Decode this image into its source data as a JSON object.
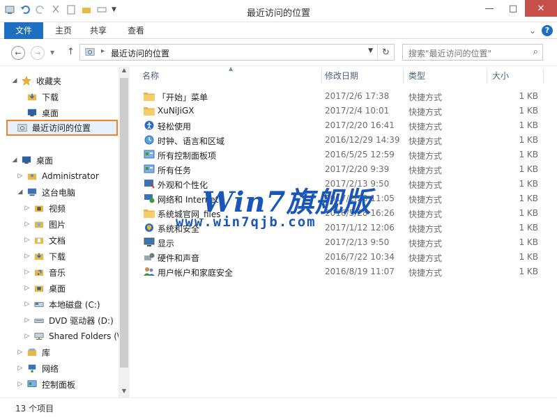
{
  "window": {
    "title": "最近访问的位置",
    "minimize": "—",
    "maximize": "□",
    "close": "✕"
  },
  "ribbon": {
    "tabs": [
      "文件",
      "主页",
      "共享",
      "查看"
    ],
    "expand": "⌄",
    "help": "?"
  },
  "address": {
    "path": "最近访问的位置",
    "separator": "▸",
    "dropdown": "▼",
    "refresh": "↻"
  },
  "search": {
    "placeholder": "搜索\"最近访问的位置\"",
    "icon": "⌕"
  },
  "nav_buttons": {
    "back": "←",
    "forward": "→",
    "up": "↑"
  },
  "tree": {
    "favorites": {
      "label": "收藏夹",
      "items": [
        "下载",
        "桌面",
        "最近访问的位置"
      ]
    },
    "desktop": {
      "label": "桌面",
      "children": [
        {
          "label": "Administrator"
        },
        {
          "label": "这台电脑",
          "children": [
            "视频",
            "图片",
            "文档",
            "下载",
            "音乐",
            "桌面",
            "本地磁盘 (C:)",
            "DVD 驱动器 (D:)",
            "Shared Folders (\\"
          ]
        },
        {
          "label": "库"
        },
        {
          "label": "网络"
        },
        {
          "label": "控制面板"
        }
      ]
    }
  },
  "columns": [
    "名称",
    "修改日期",
    "类型",
    "大小"
  ],
  "files": [
    {
      "name": "「开始」菜单",
      "date": "2017/2/6 17:38",
      "type": "快捷方式",
      "size": "1 KB",
      "icon": "folder-icon"
    },
    {
      "name": "XuNiJiGX",
      "date": "2017/2/4 10:01",
      "type": "快捷方式",
      "size": "1 KB",
      "icon": "folder-icon"
    },
    {
      "name": "轻松使用",
      "date": "2017/2/20 16:41",
      "type": "快捷方式",
      "size": "1 KB",
      "icon": "accessibility-icon"
    },
    {
      "name": "时钟、语言和区域",
      "date": "2016/12/29 14:39",
      "type": "快捷方式",
      "size": "1 KB",
      "icon": "clock-globe-icon"
    },
    {
      "name": "所有控制面板项",
      "date": "2016/5/25 12:59",
      "type": "快捷方式",
      "size": "1 KB",
      "icon": "control-panel-icon"
    },
    {
      "name": "所有任务",
      "date": "2017/2/20 9:39",
      "type": "快捷方式",
      "size": "1 KB",
      "icon": "control-panel-icon"
    },
    {
      "name": "外观和个性化",
      "date": "2017/2/13 9:50",
      "type": "快捷方式",
      "size": "1 KB",
      "icon": "appearance-icon"
    },
    {
      "name": "网络和 Internet",
      "date": "2017/2/23 11:05",
      "type": "快捷方式",
      "size": "1 KB",
      "icon": "network-icon"
    },
    {
      "name": "系统城官网_files",
      "date": "2016/5/28 16:26",
      "type": "快捷方式",
      "size": "1 KB",
      "icon": "folder-icon"
    },
    {
      "name": "系统和安全",
      "date": "2017/1/12 12:06",
      "type": "快捷方式",
      "size": "1 KB",
      "icon": "security-icon"
    },
    {
      "name": "显示",
      "date": "2017/2/13 9:50",
      "type": "快捷方式",
      "size": "1 KB",
      "icon": "display-icon"
    },
    {
      "name": "硬件和声音",
      "date": "2016/7/22 10:34",
      "type": "快捷方式",
      "size": "1 KB",
      "icon": "hardware-icon"
    },
    {
      "name": "用户帐户和家庭安全",
      "date": "2016/8/19 11:07",
      "type": "快捷方式",
      "size": "1 KB",
      "icon": "users-icon"
    }
  ],
  "status": {
    "count": "13 个项目"
  },
  "watermark": {
    "main": "Win7旗舰版",
    "sub": "www.win7qjb.com"
  },
  "colors": {
    "accent": "#1e6fc2",
    "selection_border": "#f0842d",
    "folder": "#e8b84a",
    "watermark": "#1a56b8"
  }
}
